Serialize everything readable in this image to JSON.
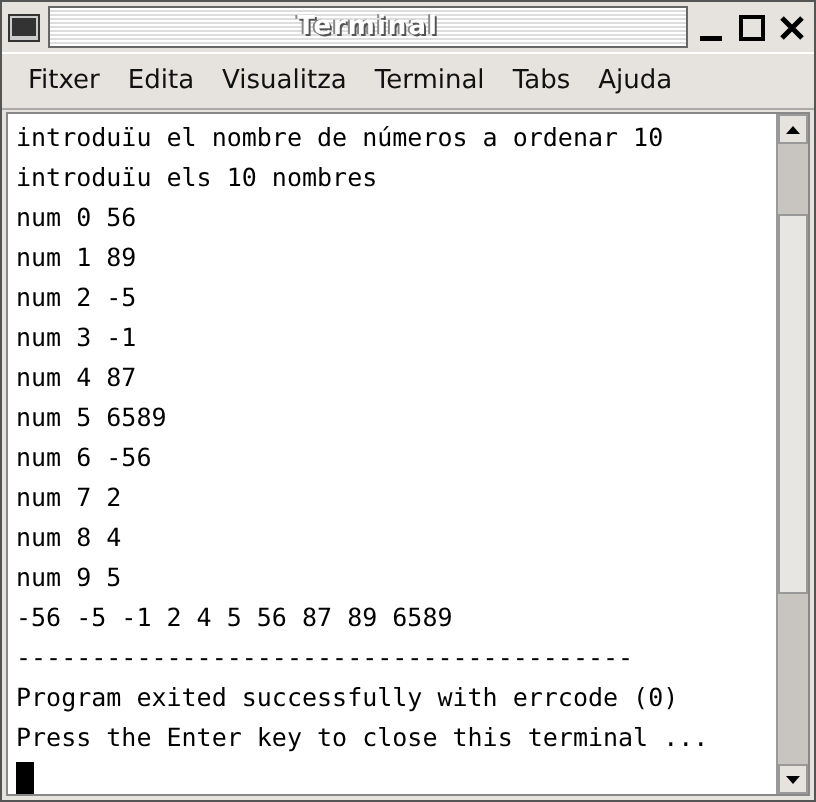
{
  "window": {
    "title": "Terminal"
  },
  "menu": [
    "Fitxer",
    "Edita",
    "Visualitza",
    "Terminal",
    "Tabs",
    "Ajuda"
  ],
  "terminal": {
    "lines": [
      "introduïu el nombre de números a ordenar 10",
      "introduïu els 10 nombres",
      "num 0 56",
      "num 1 89",
      "num 2 -5",
      "num 3 -1",
      "num 4 87",
      "num 5 6589",
      "num 6 -56",
      "num 7 2",
      "num 8 4",
      "num 9 5",
      "-56 -5 -1 2 4 5 56 87 89 6589",
      "-----------------------------------------",
      "Program exited successfully with errcode (0)",
      "Press the Enter key to close this terminal ..."
    ]
  }
}
